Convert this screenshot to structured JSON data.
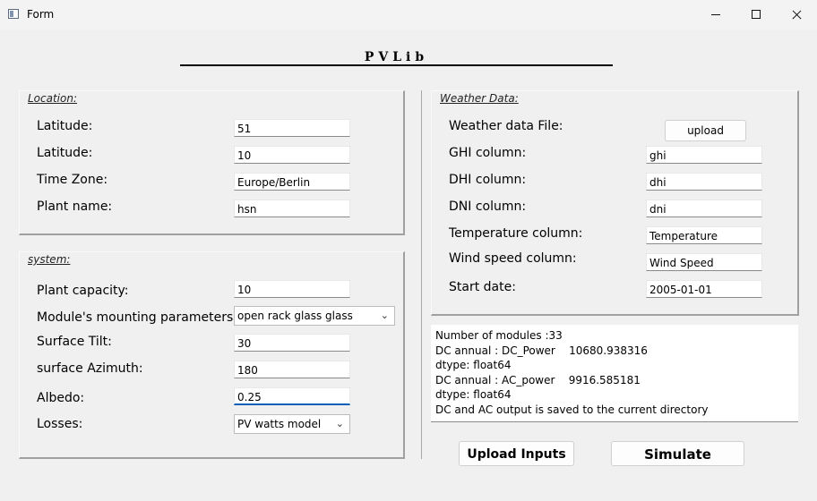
{
  "window": {
    "title": "Form",
    "icon": "form-app-icon"
  },
  "header": {
    "title": "PVLib"
  },
  "location": {
    "title": "Location:",
    "rows": [
      {
        "label": "Latitude:",
        "value": "51"
      },
      {
        "label": "Latitude:",
        "value": "10"
      },
      {
        "label": "Time Zone:",
        "value": "Europe/Berlin"
      },
      {
        "label": "Plant name:",
        "value": "hsn"
      }
    ]
  },
  "system": {
    "title": "system:",
    "capacity": {
      "label": "Plant capacity:",
      "value": "10"
    },
    "mounting": {
      "label": "Module's mounting parameters:",
      "value": "open rack glass glass"
    },
    "tilt": {
      "label": "Surface Tilt:",
      "value": "30"
    },
    "azimuth": {
      "label": "surface Azimuth:",
      "value": "180"
    },
    "albedo": {
      "label": "Albedo:",
      "value": "0.25"
    },
    "losses": {
      "label": "Losses:",
      "value": "PV watts model"
    }
  },
  "weather": {
    "title": "Weather Data:",
    "file_label": "Weather data File:",
    "upload_label": "upload",
    "rows": [
      {
        "label": "GHI column:",
        "value": "ghi"
      },
      {
        "label": "DHI column:",
        "value": "dhi"
      },
      {
        "label": "DNI column:",
        "value": "dni"
      },
      {
        "label": "Temperature column:",
        "value": "Temperature"
      },
      {
        "label": "Wind speed column:",
        "value": "Wind Speed"
      },
      {
        "label": "Start date:",
        "value": "2005-01-01"
      }
    ]
  },
  "output": {
    "lines": [
      "Number of modules :33",
      "DC annual : DC_Power    10680.938316",
      "dtype: float64",
      "DC annual : AC_power    9916.585181",
      "dtype: float64",
      "DC and AC output is saved to the current directory"
    ]
  },
  "actions": {
    "upload_inputs": "Upload Inputs",
    "simulate": "Simulate"
  },
  "colors": {
    "focus_accent": "#005fb8",
    "background": "#f0f0f0"
  }
}
